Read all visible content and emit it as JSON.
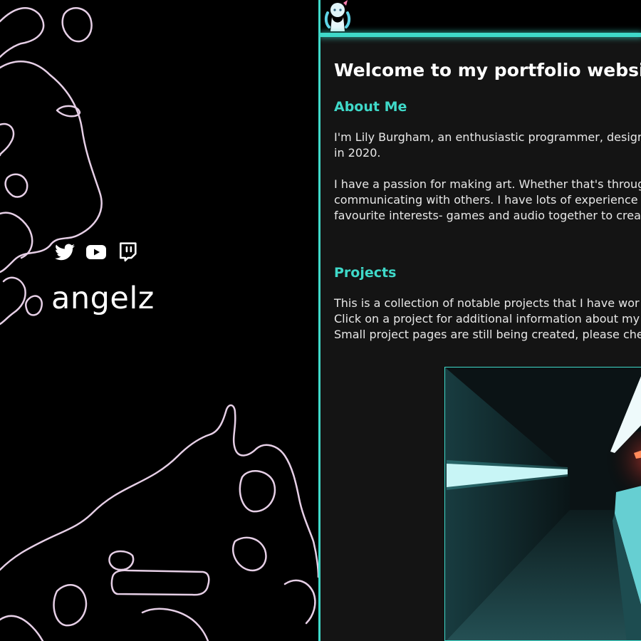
{
  "sidebar": {
    "brand_name": "angelz",
    "social_links": [
      {
        "icon": "twitter-icon",
        "label": "Twitter"
      },
      {
        "icon": "youtube-icon",
        "label": "YouTube"
      },
      {
        "icon": "twitch-icon",
        "label": "Twitch"
      }
    ]
  },
  "main": {
    "title": "Welcome to my portfolio website!",
    "about": {
      "heading": "About Me",
      "lines": [
        "I'm Lily Burgham, an enthusiastic programmer, desigr",
        "in 2020.",
        "I have a passion for making art. Whether that's throug",
        "communicating with others. I have lots of experience",
        "favourite interests- games and audio together to crea"
      ]
    },
    "projects": {
      "heading": "Projects",
      "lines": [
        "This is a collection of notable projects that I have wor",
        "Click on a project for additional information about my",
        "Small project pages are still being created, please che"
      ]
    }
  },
  "colors": {
    "accent": "#3fd9c9",
    "panel_bg": "#141414",
    "page_bg": "#000000",
    "outline": "#e6cfe6"
  }
}
